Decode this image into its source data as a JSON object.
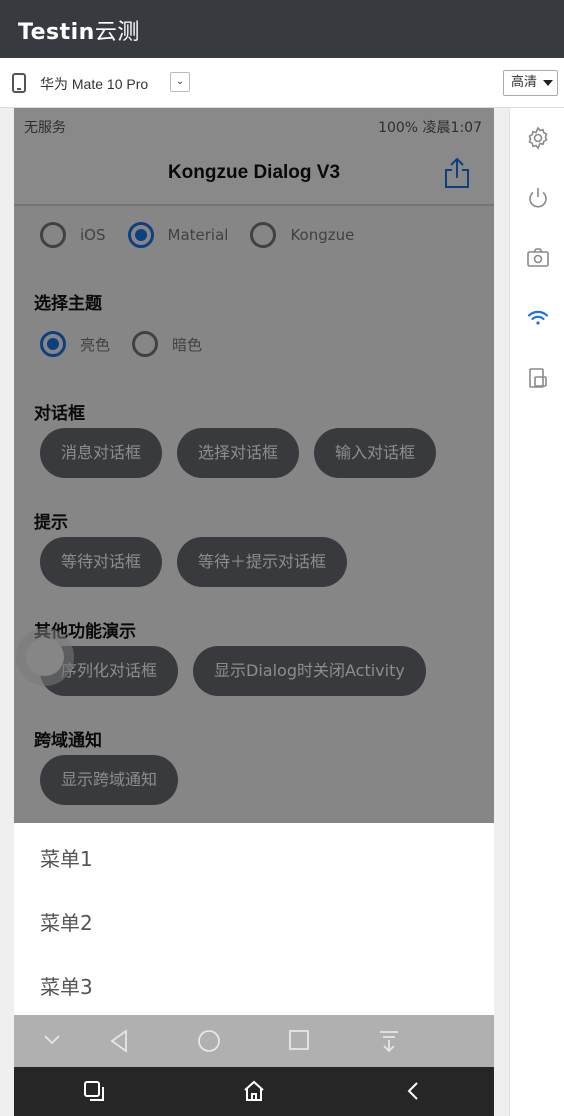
{
  "header": {
    "logo_main": "Testin",
    "logo_sub": "云测"
  },
  "device": {
    "name": "华为 Mate 10 Pro",
    "dropdown_glyph": "⌄",
    "quality": "高清"
  },
  "toolbar": {
    "icons": [
      "settings-icon",
      "power-icon",
      "camera-icon",
      "wifi-icon",
      "screen-rotate-icon"
    ]
  },
  "status_bar": {
    "left": "无服务",
    "right": "100%  凌晨1:07"
  },
  "app": {
    "title": "Kongzue Dialog V3",
    "styles": [
      {
        "label": "iOS",
        "checked": false
      },
      {
        "label": "Material",
        "checked": true
      },
      {
        "label": "Kongzue",
        "checked": false
      }
    ],
    "theme_title": "选择主题",
    "themes": [
      {
        "label": "亮色",
        "checked": true
      },
      {
        "label": "暗色",
        "checked": false
      }
    ],
    "dialog_title": "对话框",
    "dialog_buttons": [
      "消息对话框",
      "选择对话框",
      "输入对话框"
    ],
    "tip_title": "提示",
    "tip_buttons": [
      "等待对话框",
      "等待＋提示对话框"
    ],
    "other_title": "其他功能演示",
    "other_buttons": [
      "序列化对话框",
      "显示Dialog时关闭Activity"
    ],
    "notify_title": "跨域通知",
    "notify_buttons": [
      "显示跨域通知"
    ]
  },
  "menu": {
    "items": [
      "菜单1",
      "菜单2",
      "菜单3"
    ]
  },
  "colors": {
    "accent": "#1a73e8",
    "header_bg": "#373b3f",
    "pill_bg": "#666a6f",
    "nav_dark": "#262626"
  }
}
